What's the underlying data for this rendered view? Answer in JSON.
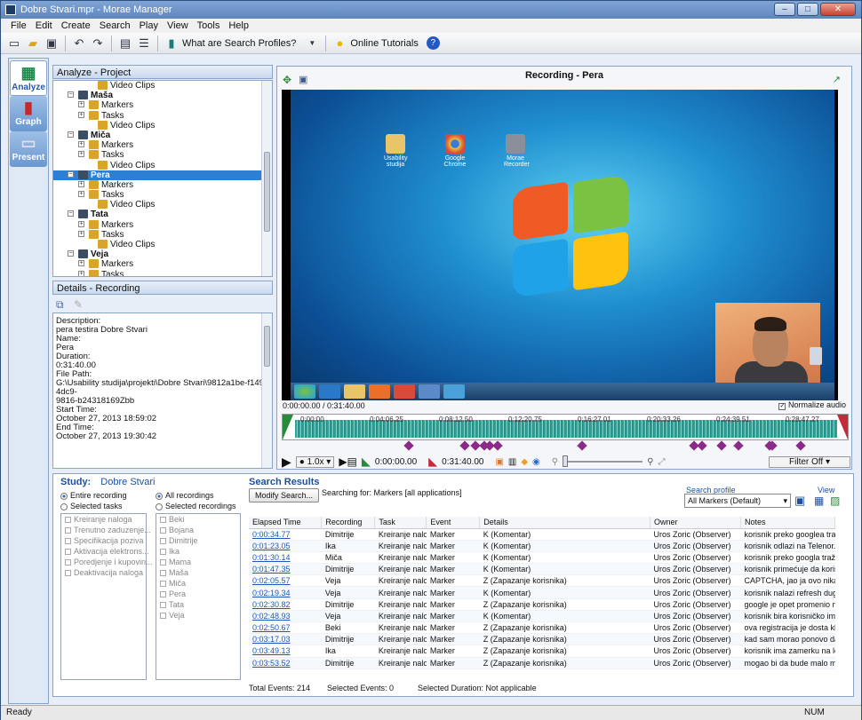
{
  "window": {
    "title": "Dobre Stvari.mpr - Morae Manager"
  },
  "menu": [
    "File",
    "Edit",
    "Create",
    "Search",
    "Play",
    "View",
    "Tools",
    "Help"
  ],
  "toolbar": {
    "profiles": "What are Search Profiles?",
    "tutorials": "Online Tutorials"
  },
  "nav": {
    "analyze": "Analyze",
    "graph": "Graph",
    "present": "Present"
  },
  "project": {
    "header": "Analyze - Project",
    "rows": [
      {
        "level": 3,
        "label": "Video Clips"
      },
      {
        "level": 1,
        "label": "Maša",
        "bold": true
      },
      {
        "level": 2,
        "label": "Markers"
      },
      {
        "level": 2,
        "label": "Tasks"
      },
      {
        "level": 3,
        "label": "Video Clips"
      },
      {
        "level": 1,
        "label": "Miča",
        "bold": true
      },
      {
        "level": 2,
        "label": "Markers"
      },
      {
        "level": 2,
        "label": "Tasks"
      },
      {
        "level": 3,
        "label": "Video Clips"
      },
      {
        "level": 1,
        "label": "Pera",
        "bold": true,
        "selected": true
      },
      {
        "level": 2,
        "label": "Markers"
      },
      {
        "level": 2,
        "label": "Tasks"
      },
      {
        "level": 3,
        "label": "Video Clips"
      },
      {
        "level": 1,
        "label": "Tata",
        "bold": true
      },
      {
        "level": 2,
        "label": "Markers"
      },
      {
        "level": 2,
        "label": "Tasks"
      },
      {
        "level": 3,
        "label": "Video Clips"
      },
      {
        "level": 1,
        "label": "Veja",
        "bold": true
      },
      {
        "level": 2,
        "label": "Markers"
      },
      {
        "level": 2,
        "label": "Tasks"
      }
    ]
  },
  "details": {
    "header": "Details - Recording",
    "lines": [
      "Description:",
      "pera testira Dobre Stvari",
      "",
      "Name:",
      "Pera",
      "",
      "Duration:",
      "0:31:40.00",
      "",
      "File Path:",
      "G:\\Usability studija\\projekti\\Dobre Stvari\\9812a1be-f149-4dc9-",
      "9816-b24318169Zbb",
      "",
      "Start Time:",
      "October 27, 2013 18:59:02",
      "",
      "End Time:",
      "October 27, 2013 19:30:42"
    ]
  },
  "recording": {
    "title": "Recording - Pera",
    "time": "0:00:00.00 / 0:31:40.00",
    "normalize": "Normalize audio",
    "ticks": [
      "0:00:00",
      "0:04:06.25",
      "0:08:12.50",
      "0:12:20.75",
      "0:16:27.01",
      "0:20:33.26",
      "0:24:39.51",
      "0:28:47.27"
    ],
    "speed": "1.0x",
    "in": "0:00:00.00",
    "out": "0:31:40.00",
    "filter": "Filter Off",
    "desktop_icons": [
      "Usability studija",
      "Google Chrome",
      "Morae Recorder"
    ]
  },
  "study": {
    "label": "Study:",
    "name": "Dobre Stvari",
    "entire": "Entire recording",
    "selected_tasks": "Selected tasks",
    "all_rec": "All recordings",
    "sel_rec": "Selected recordings",
    "tasks": [
      "Kreiranje naloga",
      "Trenutno zaduzenje...",
      "Specifikacija poziva",
      "Aktivacija elektrons...",
      "Poredjenje i kupovin...",
      "Deaktivacija naloga"
    ],
    "recordings": [
      "Beki",
      "Bojana",
      "Dimitrije",
      "Ika",
      "Mama",
      "Maša",
      "Miča",
      "Pera",
      "Tata",
      "Veja"
    ]
  },
  "search": {
    "title": "Search Results",
    "modify": "Modify Search...",
    "for": "Searching for: Markers [all applications]",
    "profile_label": "Search profile",
    "profile": "All Markers (Default)",
    "view": "View",
    "columns": [
      "Elapsed Time",
      "Recording",
      "Task",
      "Event",
      "Details",
      "Owner",
      "Notes"
    ],
    "rows": [
      [
        "0:00:34.77",
        "Dimitrije",
        "Kreiranje naloga",
        "Marker",
        "K (Komentar)",
        "Uros Zoric (Observer)",
        "korisnik preko googlea traži do"
      ],
      [
        "0:01:23.05",
        "Ika",
        "Kreiranje naloga",
        "Marker",
        "K (Komentar)",
        "Uros Zoric (Observer)",
        "korisnik odlazi na Telenor.rs oč"
      ],
      [
        "0:01:30.14",
        "Miča",
        "Kreiranje naloga",
        "Marker",
        "K (Komentar)",
        "Uros Zoric (Observer)",
        "korisnik preko googla traži por"
      ],
      [
        "0:01:47.35",
        "Dimitrije",
        "Kreiranje naloga",
        "Marker",
        "K (Komentar)",
        "Uros Zoric (Observer)",
        "korisnik primećuje da korisnič"
      ],
      [
        "0:02:05.57",
        "Veja",
        "Kreiranje naloga",
        "Marker",
        "Z (Zapazanje korisnika)",
        "Uros Zoric (Observer)",
        "CAPTCHA, jao ja ovo nikad ne"
      ],
      [
        "0:02:19.34",
        "Veja",
        "Kreiranje naloga",
        "Marker",
        "K (Komentar)",
        "Uros Zoric (Observer)",
        "korisnik nalazi refresh dugme i"
      ],
      [
        "0:02:30.82",
        "Dimitrije",
        "Kreiranje naloga",
        "Marker",
        "Z (Zapazanje korisnika)",
        "Uros Zoric (Observer)",
        "google je opet promenio nešto"
      ],
      [
        "0:02:48.93",
        "Veja",
        "Kreiranje naloga",
        "Marker",
        "K (Komentar)",
        "Uros Zoric (Observer)",
        "korisnik bira korisničko ime koje"
      ],
      [
        "0:02:50.67",
        "Beki",
        "Kreiranje naloga",
        "Marker",
        "Z (Zapazanje korisnika)",
        "Uros Zoric (Observer)",
        "ova registracija je dosta klasič"
      ],
      [
        "0:03:17.03",
        "Dimitrije",
        "Kreiranje naloga",
        "Marker",
        "Z (Zapazanje korisnika)",
        "Uros Zoric (Observer)",
        "kad sam morao ponovo da kuc"
      ],
      [
        "0:03:49.13",
        "Ika",
        "Kreiranje naloga",
        "Marker",
        "Z (Zapazanje korisnika)",
        "Uros Zoric (Observer)",
        "korisnik ima zamerku na lozink"
      ],
      [
        "0:03:53.52",
        "Dimitrije",
        "Kreiranje naloga",
        "Marker",
        "Z (Zapazanje korisnika)",
        "Uros Zoric (Observer)",
        "mogao bi da bude malo manje"
      ]
    ],
    "total": "Total Events:  214",
    "selected": "Selected Events:  0",
    "duration": "Selected Duration:  Not applicable"
  },
  "status": {
    "left": "Ready",
    "right": "NUM"
  }
}
